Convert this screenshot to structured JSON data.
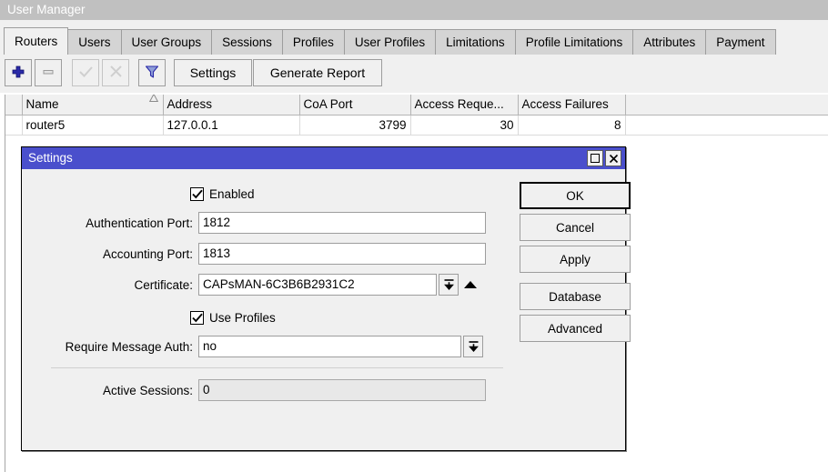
{
  "window": {
    "title": "User Manager"
  },
  "tabs": [
    {
      "label": "Routers",
      "active": true
    },
    {
      "label": "Users",
      "active": false
    },
    {
      "label": "User Groups",
      "active": false
    },
    {
      "label": "Sessions",
      "active": false
    },
    {
      "label": "Profiles",
      "active": false
    },
    {
      "label": "User Profiles",
      "active": false
    },
    {
      "label": "Limitations",
      "active": false
    },
    {
      "label": "Profile Limitations",
      "active": false
    },
    {
      "label": "Attributes",
      "active": false
    },
    {
      "label": "Payment",
      "active": false
    }
  ],
  "toolbar": {
    "add_icon": "plus-icon",
    "remove_icon": "minus-icon",
    "enable_icon": "check-icon",
    "disable_icon": "cross-icon",
    "filter_icon": "funnel-icon",
    "settings_label": "Settings",
    "generate_report_label": "Generate Report"
  },
  "table": {
    "columns": [
      {
        "label": "Name",
        "sorted": "ascending",
        "align": "left"
      },
      {
        "label": "Address",
        "align": "left"
      },
      {
        "label": "CoA Port",
        "align": "right"
      },
      {
        "label": "Access Reque...",
        "align": "right"
      },
      {
        "label": "Access Failures",
        "align": "right"
      }
    ],
    "rows": [
      {
        "name": "router5",
        "address": "127.0.0.1",
        "coa_port": "3799",
        "access_requests": "30",
        "access_failures": "8"
      }
    ]
  },
  "dialog": {
    "title": "Settings",
    "maximize_icon": "maximize-icon",
    "close_icon": "close-icon",
    "enabled": {
      "label": "Enabled",
      "checked": true
    },
    "fields": [
      {
        "label": "Authentication Port:",
        "value": "1812"
      },
      {
        "label": "Accounting Port:",
        "value": "1813"
      },
      {
        "label": "Certificate:",
        "value": "CAPsMAN-6C3B6B2931C2"
      },
      {
        "label": "Require Message Auth:",
        "value": "no"
      },
      {
        "label": "Active Sessions:",
        "value": "0"
      }
    ],
    "use_profiles": {
      "label": "Use Profiles",
      "checked": true
    },
    "buttons": [
      {
        "label": "OK",
        "primary": true
      },
      {
        "label": "Cancel",
        "primary": false
      },
      {
        "label": "Apply",
        "primary": false
      },
      {
        "label": "Database",
        "primary": false
      },
      {
        "label": "Advanced",
        "primary": false
      }
    ]
  },
  "colors": {
    "titlebar_strip": "#c0c0c0",
    "dialog_titlebar": "#4a4fcc",
    "chrome": "#f0f0f0",
    "tab_inactive": "#d4d4d4",
    "accent_icon": "#2a2aa8"
  }
}
